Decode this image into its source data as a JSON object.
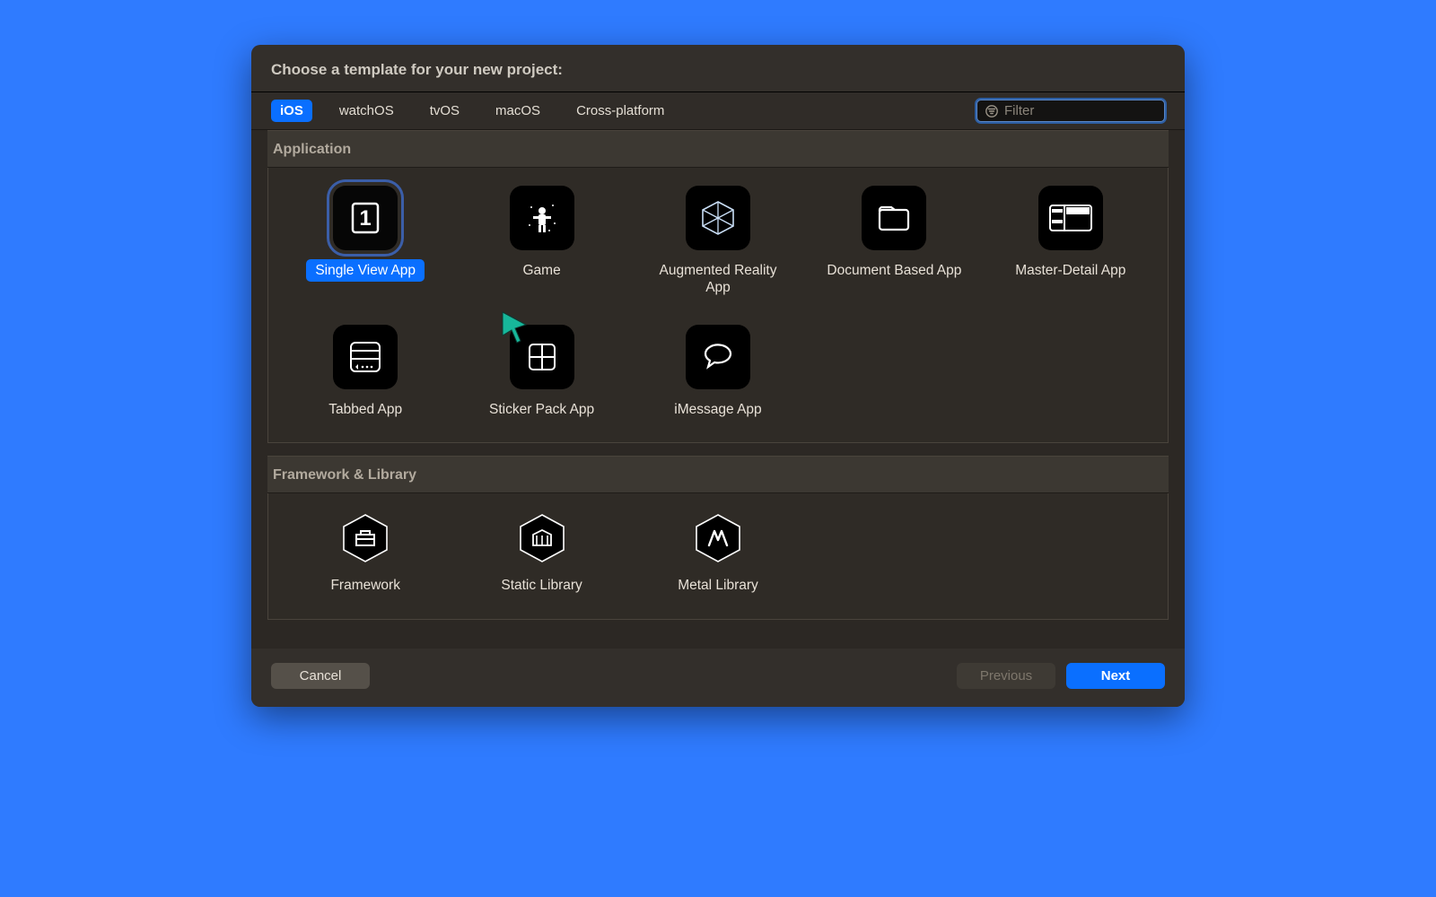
{
  "title": "Choose a template for your new project:",
  "tabs": [
    "iOS",
    "watchOS",
    "tvOS",
    "macOS",
    "Cross-platform"
  ],
  "selected_tab": 0,
  "filter": {
    "placeholder": "Filter",
    "value": ""
  },
  "sections": {
    "application": {
      "title": "Application",
      "items": [
        {
          "label": "Single View App",
          "icon": "single-view-icon",
          "selected": true
        },
        {
          "label": "Game",
          "icon": "game-icon"
        },
        {
          "label": "Augmented Reality App",
          "icon": "ar-icon"
        },
        {
          "label": "Document Based App",
          "icon": "document-icon"
        },
        {
          "label": "Master-Detail App",
          "icon": "master-detail-icon"
        },
        {
          "label": "Tabbed App",
          "icon": "tabbed-icon"
        },
        {
          "label": "Sticker Pack App",
          "icon": "sticker-icon"
        },
        {
          "label": "iMessage App",
          "icon": "imessage-icon"
        }
      ]
    },
    "framework": {
      "title": "Framework & Library",
      "items": [
        {
          "label": "Framework",
          "icon": "framework-icon"
        },
        {
          "label": "Static Library",
          "icon": "static-lib-icon"
        },
        {
          "label": "Metal Library",
          "icon": "metal-lib-icon"
        }
      ]
    }
  },
  "buttons": {
    "cancel": "Cancel",
    "previous": "Previous",
    "next": "Next"
  }
}
